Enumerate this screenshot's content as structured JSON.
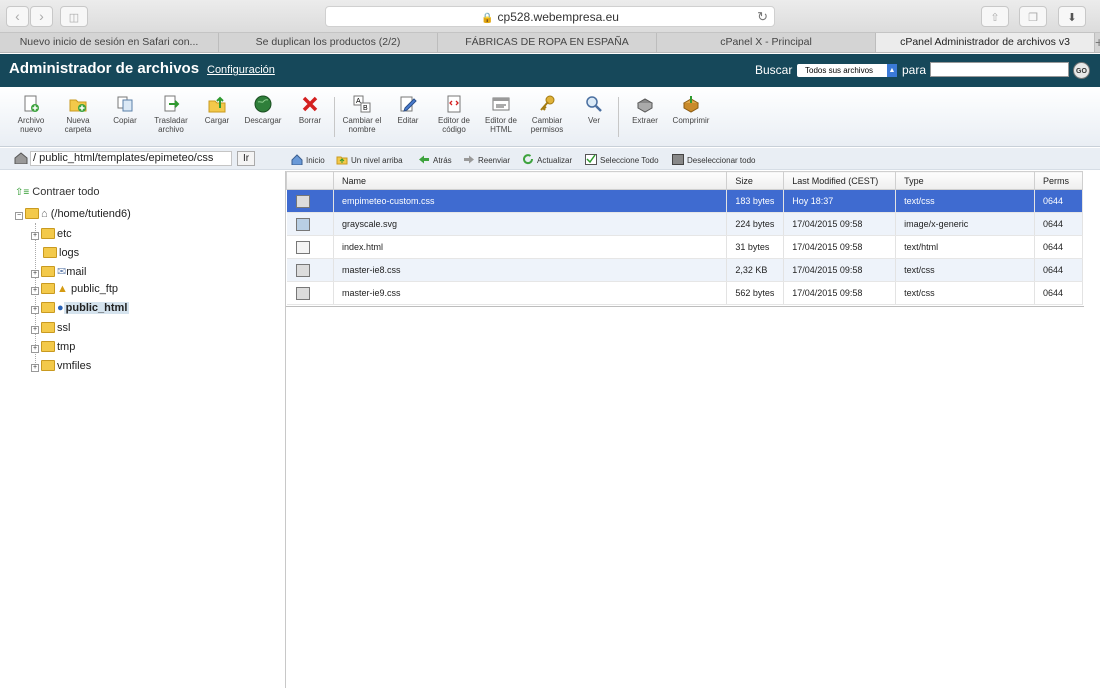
{
  "browser": {
    "url": "cp528.webempresa.eu",
    "tabs": [
      {
        "label": "Nuevo inicio de sesión en Safari con..."
      },
      {
        "label": "Se duplican los productos (2/2)"
      },
      {
        "label": "FÁBRICAS DE ROPA EN ESPAÑA"
      },
      {
        "label": "cPanel X - Principal"
      },
      {
        "label": "cPanel Administrador de archivos v3"
      }
    ],
    "new_tab": "+"
  },
  "header": {
    "title": "Administrador de archivos",
    "config_link": "Configuración",
    "search_label": "Buscar",
    "search_scope": "Todos sus archivos",
    "for_label": "para",
    "go": "GO"
  },
  "toolbar": {
    "items": [
      {
        "label": "Archivo nuevo",
        "icon": "new-file-icon"
      },
      {
        "label": "Nueva carpeta",
        "icon": "new-folder-icon"
      },
      {
        "label": "Copiar",
        "icon": "copy-icon"
      },
      {
        "label": "Trasladar archivo",
        "icon": "move-icon"
      },
      {
        "label": "Cargar",
        "icon": "upload-icon"
      },
      {
        "label": "Descargar",
        "icon": "download-icon"
      },
      {
        "label": "Borrar",
        "icon": "delete-icon"
      },
      {
        "label": "Cambiar el nombre",
        "icon": "rename-icon"
      },
      {
        "label": "Editar",
        "icon": "edit-icon"
      },
      {
        "label": "Editor de código",
        "icon": "code-editor-icon"
      },
      {
        "label": "Editor de HTML",
        "icon": "html-editor-icon"
      },
      {
        "label": "Cambiar permisos",
        "icon": "permissions-icon"
      },
      {
        "label": "Ver",
        "icon": "view-icon"
      },
      {
        "label": "Extraer",
        "icon": "extract-icon"
      },
      {
        "label": "Comprimir",
        "icon": "compress-icon"
      }
    ]
  },
  "path": {
    "value": "/ public_html/templates/epimeteo/css",
    "go_label": "Ir"
  },
  "actions": {
    "home": "Inicio",
    "up": "Un nivel arriba",
    "back": "Atrás",
    "forward": "Reenviar",
    "refresh": "Actualizar",
    "select_all": "Seleccione Todo",
    "deselect_all": "Deseleccionar todo"
  },
  "tree": {
    "collapse_all": "Contraer todo",
    "root": "(/home/tutiend6)",
    "items": [
      {
        "label": "etc"
      },
      {
        "label": "logs"
      },
      {
        "label": "mail"
      },
      {
        "label": "public_ftp"
      },
      {
        "label": "public_html"
      },
      {
        "label": "ssl"
      },
      {
        "label": "tmp"
      },
      {
        "label": "vmfiles"
      }
    ]
  },
  "files": {
    "columns": [
      "Name",
      "Size",
      "Last Modified (CEST)",
      "Type",
      "Perms"
    ],
    "rows": [
      {
        "name": "empimeteo-custom.css",
        "size": "183 bytes",
        "modified": "Hoy 18:37",
        "type": "text/css",
        "perms": "0644"
      },
      {
        "name": "grayscale.svg",
        "size": "224 bytes",
        "modified": "17/04/2015 09:58",
        "type": "image/x-generic",
        "perms": "0644"
      },
      {
        "name": "index.html",
        "size": "31 bytes",
        "modified": "17/04/2015 09:58",
        "type": "text/html",
        "perms": "0644"
      },
      {
        "name": "master-ie8.css",
        "size": "2,32 KB",
        "modified": "17/04/2015 09:58",
        "type": "text/css",
        "perms": "0644"
      },
      {
        "name": "master-ie9.css",
        "size": "562 bytes",
        "modified": "17/04/2015 09:58",
        "type": "text/css",
        "perms": "0644"
      }
    ]
  },
  "colors": {
    "header_bg": "#16485a",
    "selected_row": "#3f6bd0"
  }
}
